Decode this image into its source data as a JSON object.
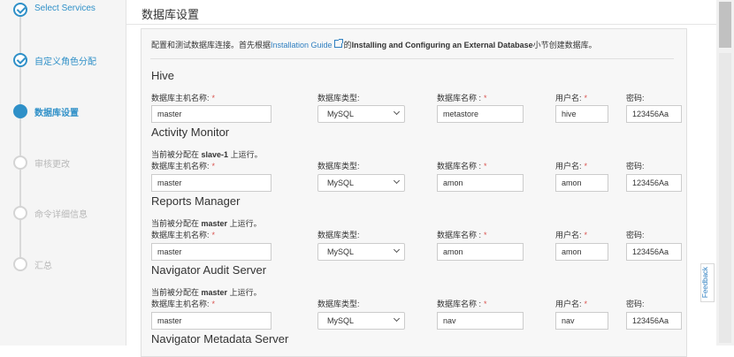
{
  "steps": [
    {
      "label": "Select Services",
      "state": "done"
    },
    {
      "label": "自定义角色分配",
      "state": "done"
    },
    {
      "label": "数据库设置",
      "state": "active"
    },
    {
      "label": "审核更改",
      "state": "todo"
    },
    {
      "label": "命令详细信息",
      "state": "todo"
    },
    {
      "label": "汇总",
      "state": "todo"
    }
  ],
  "page_title": "数据库设置",
  "intro": {
    "prefix": "配置和测试数据库连接。首先根据",
    "link": "Installation Guide",
    "middle": "的",
    "bold": "Installing and Configuring an External Database",
    "suffix": "小节创建数据库。"
  },
  "field_labels": {
    "host": "数据库主机名称:",
    "type": "数据库类型:",
    "name": "数据库名称 :",
    "user": "用户名:",
    "password": "密码:"
  },
  "assigned_prefix": "当前被分配在",
  "assigned_suffix": "上运行。",
  "sections": [
    {
      "title": "Hive",
      "assigned_host": "",
      "host": "master",
      "type": "MySQL",
      "db_name": "metastore",
      "user": "hive",
      "password": "123456Aa"
    },
    {
      "title": "Activity Monitor",
      "assigned_host": "slave-1",
      "host": "master",
      "type": "MySQL",
      "db_name": "amon",
      "user": "amon",
      "password": "123456Aa"
    },
    {
      "title": "Reports Manager",
      "assigned_host": "master",
      "host": "master",
      "type": "MySQL",
      "db_name": "amon",
      "user": "amon",
      "password": "123456Aa"
    },
    {
      "title": "Navigator Audit Server",
      "assigned_host": "master",
      "host": "master",
      "type": "MySQL",
      "db_name": "nav",
      "user": "nav",
      "password": "123456Aa"
    }
  ],
  "next_section_title": "Navigator Metadata Server",
  "feedback_label": "Feedback",
  "colors": {
    "accent": "#2f90c8",
    "required": "#d9534f",
    "link": "#2f7fc0"
  }
}
